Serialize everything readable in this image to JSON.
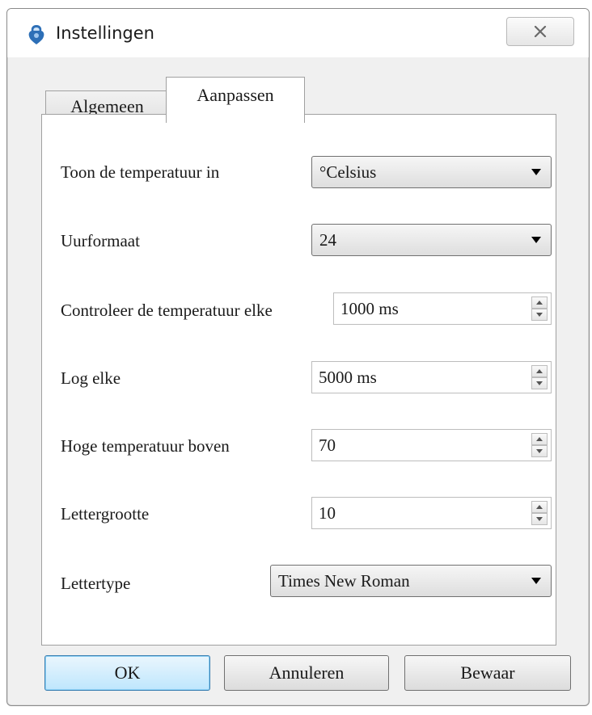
{
  "window": {
    "title": "Instellingen",
    "close_icon": "close-icon"
  },
  "tabs": [
    {
      "label": "Algemeen",
      "active": false
    },
    {
      "label": "Aanpassen",
      "active": true
    }
  ],
  "settings": {
    "temperature_unit": {
      "label": "Toon de temperatuur in",
      "value": "°Celsius"
    },
    "hour_format": {
      "label": "Uurformaat",
      "value": "24"
    },
    "check_interval": {
      "label": "Controleer de temperatuur elke",
      "value": "1000 ms"
    },
    "log_interval": {
      "label": "Log elke",
      "value": "5000 ms"
    },
    "high_temp": {
      "label": "Hoge temperatuur boven",
      "value": "70"
    },
    "font_size": {
      "label": "Lettergrootte",
      "value": "10"
    },
    "font_family": {
      "label": "Lettertype",
      "value": "Times New Roman"
    }
  },
  "buttons": {
    "ok": "OK",
    "cancel": "Annuleren",
    "save": "Bewaar"
  },
  "colors": {
    "default_button_border": "#3c7fb1",
    "panel_background": "#ffffff"
  }
}
